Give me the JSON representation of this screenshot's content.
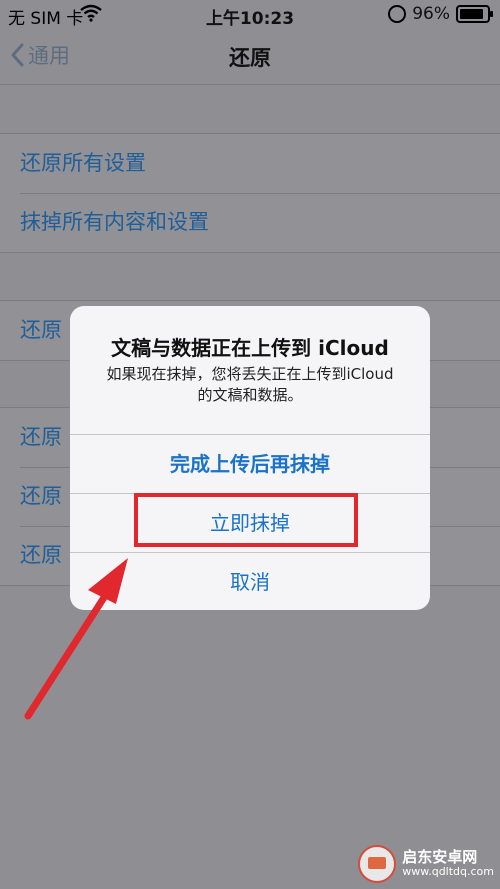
{
  "status_bar": {
    "carrier": "无 SIM 卡",
    "time": "上午10:23",
    "battery": "96%",
    "battery_level": 0.96
  },
  "nav": {
    "back_label": "通用",
    "title": "还原"
  },
  "list": {
    "group1": [
      "还原所有设置",
      "抹掉所有内容和设置"
    ],
    "group2_first": "还原",
    "group3": [
      "还原",
      "还原",
      "还原"
    ]
  },
  "alert": {
    "title": "文稿与数据正在上传到 iCloud",
    "message": "如果现在抹掉，您将丢失正在上传到iCloud的文稿和数据。",
    "buttons": [
      "完成上传后再抹掉",
      "立即抹掉",
      "取消"
    ]
  },
  "highlight_color": "#e0282e",
  "accent_color": "#1a73c9",
  "watermark": {
    "name": "启东安卓网",
    "url": "www.qdltdq.com"
  }
}
